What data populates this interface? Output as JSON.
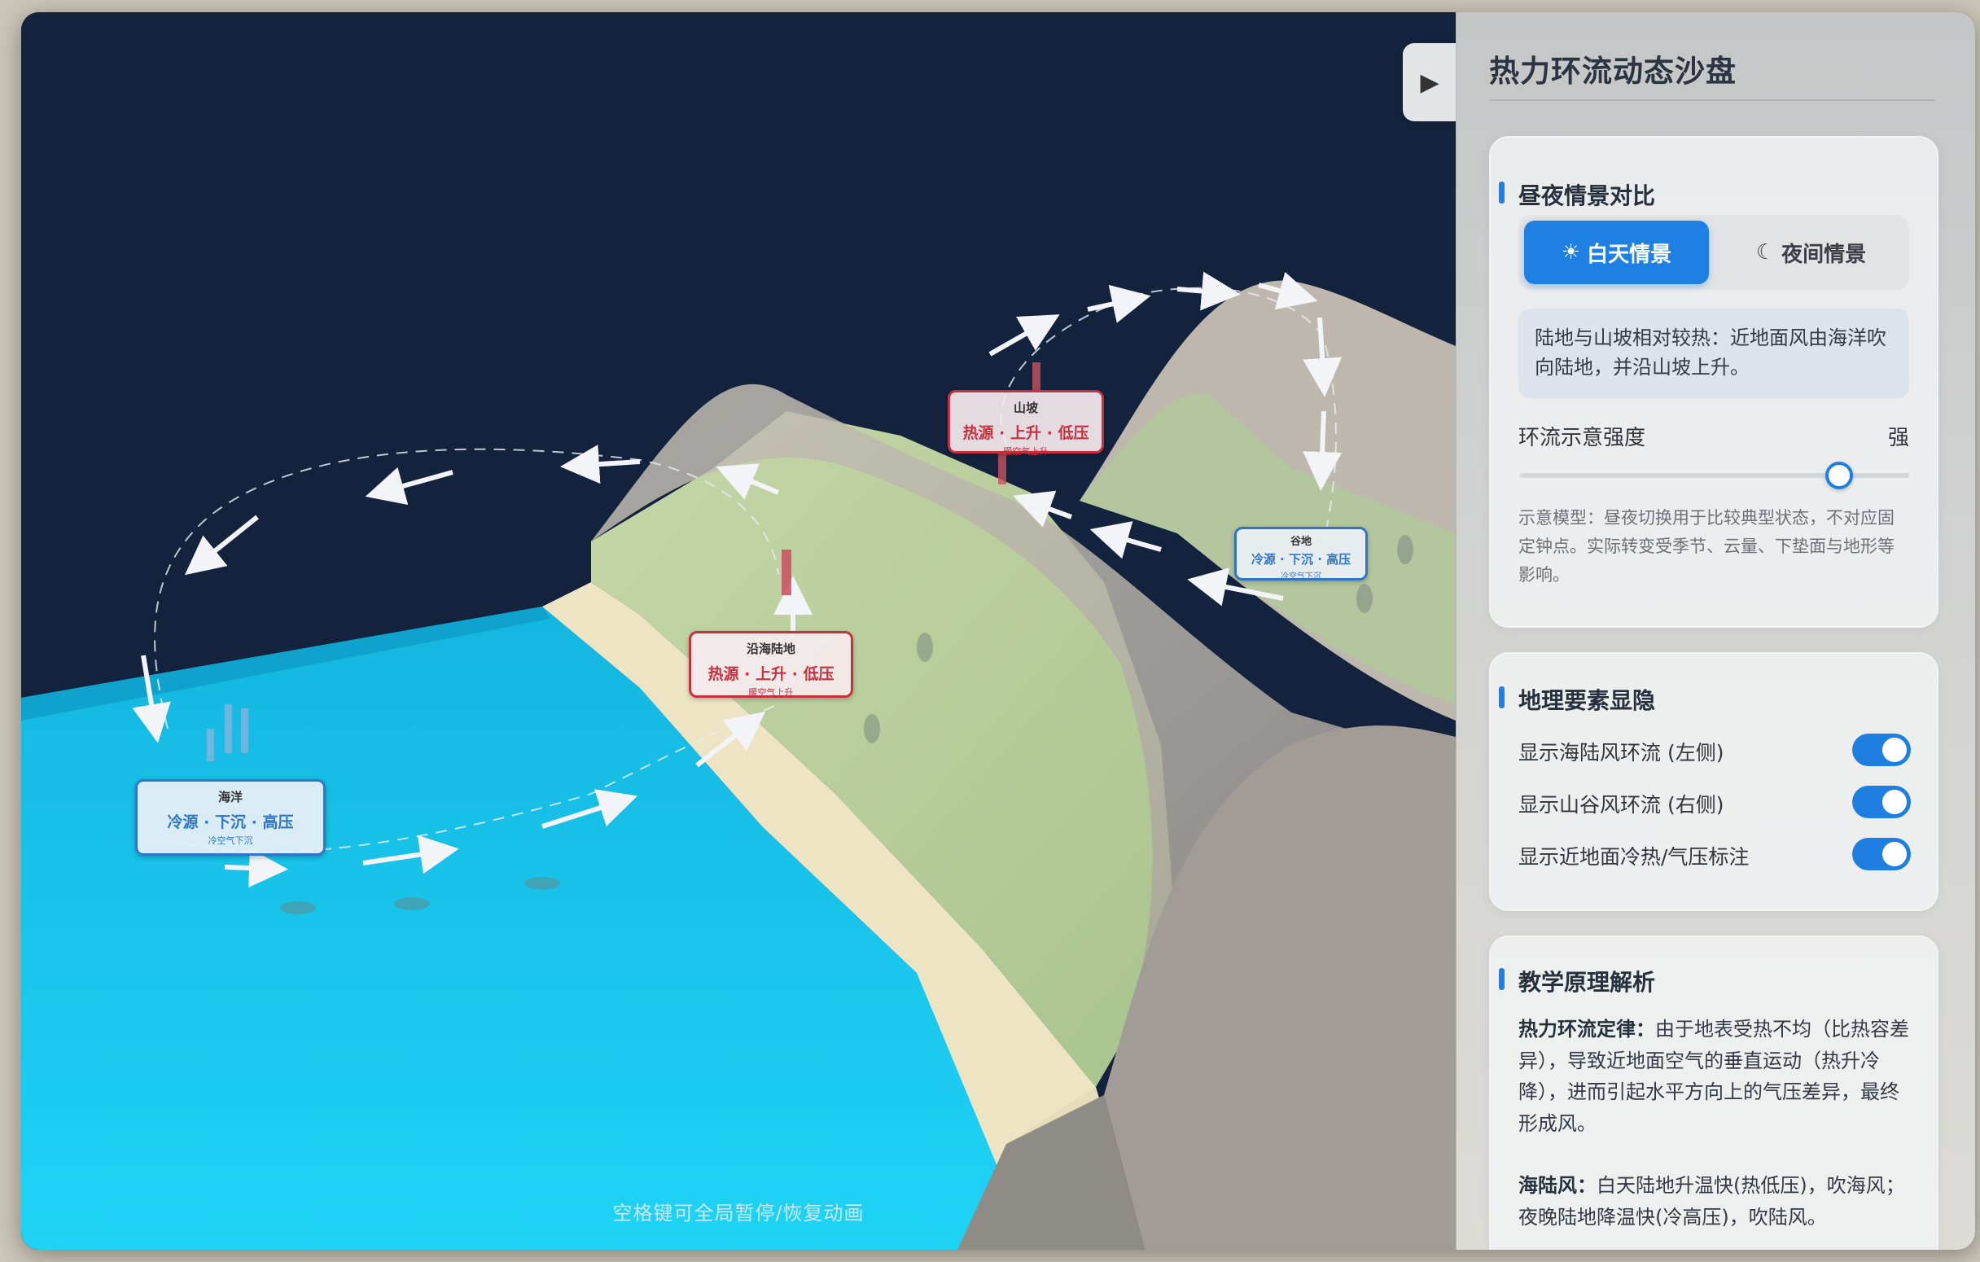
{
  "panel": {
    "title": "热力环流动态沙盘"
  },
  "scenario": {
    "heading": "昼夜情景对比",
    "day_button": {
      "icon": "sun-icon",
      "glyph": "☀",
      "label": "白天情景"
    },
    "night_button": {
      "icon": "moon-icon",
      "glyph": "☾",
      "label": "夜间情景"
    },
    "selected": "day",
    "description": "陆地与山坡相对较热：近地面风由海洋吹向陆地，并沿山坡上升。",
    "strength_label": "环流示意强度",
    "strength_value": "强",
    "strength_level": 0.82,
    "hint": "示意模型：昼夜切换用于比较典型状态，不对应固定钟点。实际转变受季节、云量、下垫面与地形等影响。"
  },
  "toggles": {
    "heading": "地理要素显隐",
    "items": [
      {
        "label": "显示海陆风环流 (左侧)",
        "on": true
      },
      {
        "label": "显示山谷风环流 (右侧)",
        "on": true
      },
      {
        "label": "显示近地面冷热/气压标注",
        "on": true
      }
    ]
  },
  "principles": {
    "heading": "教学原理解析",
    "p1_title": "热力环流定律：",
    "p1_text": "由于地表受热不均（比热容差异），导致近地面空气的垂直运动（热升冷降），进而引起水平方向上的气压差异，最终形成风。",
    "p2_title": "海陆风：",
    "p2_text": "白天陆地升温快(热低压)，吹海风；夜晚陆地降温快(冷高压)，吹陆风。"
  },
  "scene": {
    "play_glyph": "▶",
    "footer_hint": "空格键可全局暂停/恢复动画",
    "labels": [
      {
        "name": "海洋",
        "main": "冷源 · 下沉 · 高压",
        "sub": "冷空气下沉",
        "kind": "cold"
      },
      {
        "name": "沿海陆地",
        "main": "热源 · 上升 · 低压",
        "sub": "暖空气上升",
        "kind": "hot"
      },
      {
        "name": "山坡",
        "main": "热源 · 上升 · 低压",
        "sub": "暖空气上升",
        "kind": "hot"
      },
      {
        "name": "谷地",
        "main": "冷源 · 下沉 · 高压",
        "sub": "冷空气下沉",
        "kind": "cold"
      }
    ],
    "colors": {
      "sky": "#13233d",
      "sea": "#1fc8ee",
      "sand": "#ece4c2",
      "grass": "#b8cf9a",
      "ridge": "#b5b0a6",
      "accent": "#1f80e4",
      "hot": "#c83040",
      "cold": "#2e77c8"
    }
  }
}
